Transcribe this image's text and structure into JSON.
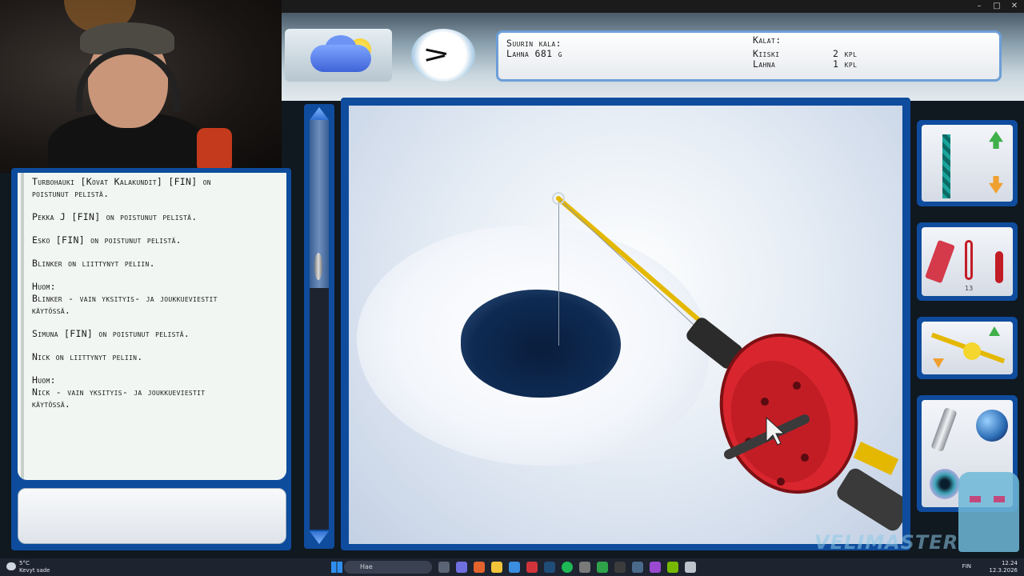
{
  "window": {
    "minimize": "–",
    "maximize": "□",
    "close": "✕"
  },
  "catch_panel": {
    "biggest_label": "Suurin kala:",
    "biggest_value": "Lahna 681 g",
    "fish_label": "Kalat:",
    "fish": [
      {
        "name": "Kiiski",
        "count": "2 kpl"
      },
      {
        "name": "Lahna",
        "count": "1 kpl"
      }
    ]
  },
  "chat": {
    "lines": [
      "Turbohauki [Kovat Kalakundit] [FIN] on\npoistunut pelistä.",
      "Pekka J [FIN] on poistunut pelistä.",
      "Esko [FIN] on poistunut pelistä.",
      "Blinker on liittynyt peliin.",
      "Huom:\nBlinker - vain yksityis- ja joukkueviestit\nkäytössä.",
      "Simuna [FIN] on poistunut pelistä.",
      "Nick on liittynyt peliin.",
      "Huom:\nNick - vain yksityis- ja joukkueviestit\nkäytössä."
    ]
  },
  "tools": {
    "drill_count": "",
    "lure_count": "13"
  },
  "watermark": "VELIMASTER",
  "taskbar": {
    "weather_temp": "5°C",
    "weather_desc": "Kevyt sade",
    "search_placeholder": "Hae",
    "lang": "FIN",
    "time": "12.24",
    "date": "12.3.2026"
  },
  "colors": {
    "frame": "#0f4c9d",
    "rod": "#e4b800",
    "reel": "#d9262e",
    "panel_border": "#6d9ed8"
  }
}
